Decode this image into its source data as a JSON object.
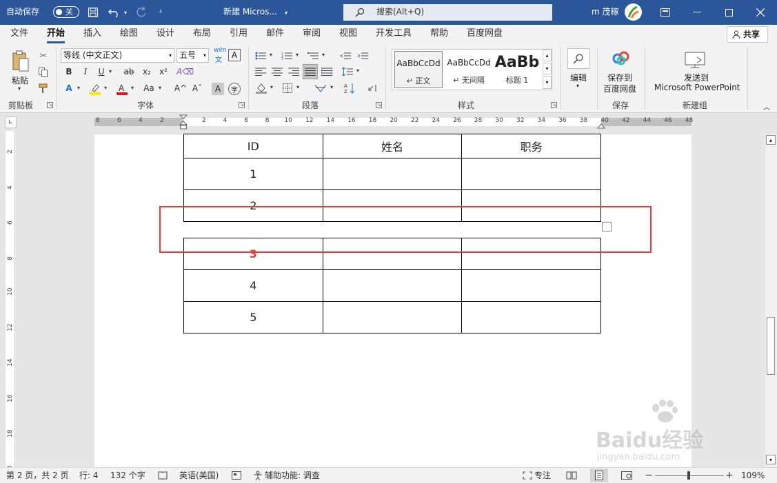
{
  "titlebar": {
    "autosave_label": "自动保存",
    "autosave_state": "关",
    "doc_title": "新建 Micros...",
    "search_placeholder": "搜索(Alt+Q)",
    "user_name": "m 茂稼"
  },
  "tabs": [
    {
      "label": "文件"
    },
    {
      "label": "开始"
    },
    {
      "label": "插入"
    },
    {
      "label": "绘图"
    },
    {
      "label": "设计"
    },
    {
      "label": "布局"
    },
    {
      "label": "引用"
    },
    {
      "label": "邮件"
    },
    {
      "label": "审阅"
    },
    {
      "label": "视图"
    },
    {
      "label": "开发工具"
    },
    {
      "label": "帮助"
    },
    {
      "label": "百度网盘"
    }
  ],
  "share_label": "共享",
  "ribbon": {
    "clipboard": {
      "group": "剪贴板",
      "paste": "粘贴"
    },
    "font": {
      "group": "字体",
      "font_name": "等线 (中文正文)",
      "font_size": "五号",
      "phonetic": "wén"
    },
    "paragraph": {
      "group": "段落"
    },
    "styles": {
      "group": "样式",
      "items": [
        {
          "preview": "AaBbCcDd",
          "name": "正文"
        },
        {
          "preview": "AaBbCcDd",
          "name": "无间隔"
        },
        {
          "preview": "AaBb",
          "name": "标题 1"
        }
      ]
    },
    "editing": {
      "label": "编辑"
    },
    "save": {
      "group": "保存",
      "line1": "保存到",
      "line2": "百度网盘"
    },
    "newgroup": {
      "group": "新建组",
      "line1": "发送到",
      "line2": "Microsoft PowerPoint"
    }
  },
  "ruler_h": {
    "left": [
      "8",
      "6",
      "4",
      "2"
    ],
    "right": [
      "2",
      "4",
      "6",
      "8",
      "10",
      "12",
      "14",
      "16",
      "18",
      "20",
      "22",
      "24",
      "26",
      "28",
      "30",
      "32",
      "34",
      "36",
      "38",
      "40",
      "42",
      "44",
      "46",
      "48"
    ]
  },
  "ruler_v": [
    "2",
    "4",
    "6",
    "8",
    "10",
    "12",
    "14",
    "16",
    "18",
    "20"
  ],
  "table": {
    "headers": [
      "ID",
      "姓名",
      "职务"
    ],
    "rows_top": [
      [
        "1",
        "",
        ""
      ],
      [
        "2",
        "",
        ""
      ]
    ],
    "rows_bottom": [
      [
        "3",
        "",
        ""
      ],
      [
        "4",
        "",
        ""
      ],
      [
        "5",
        "",
        ""
      ]
    ]
  },
  "colors": {
    "title_bar": "#2b579a",
    "highlight_box": "#e53a3a",
    "highlighted_cell_text": "#e53a3a"
  },
  "status": {
    "page": "第 2 页，共 2 页",
    "row": "行: 4",
    "words": "132 个字",
    "language": "英语(美国)",
    "accessibility": "辅助功能: 调查",
    "focus": "专注",
    "zoom": "109%"
  },
  "watermark": {
    "line1": "Baidu经验",
    "line2": "jingyan.baidu.com"
  }
}
